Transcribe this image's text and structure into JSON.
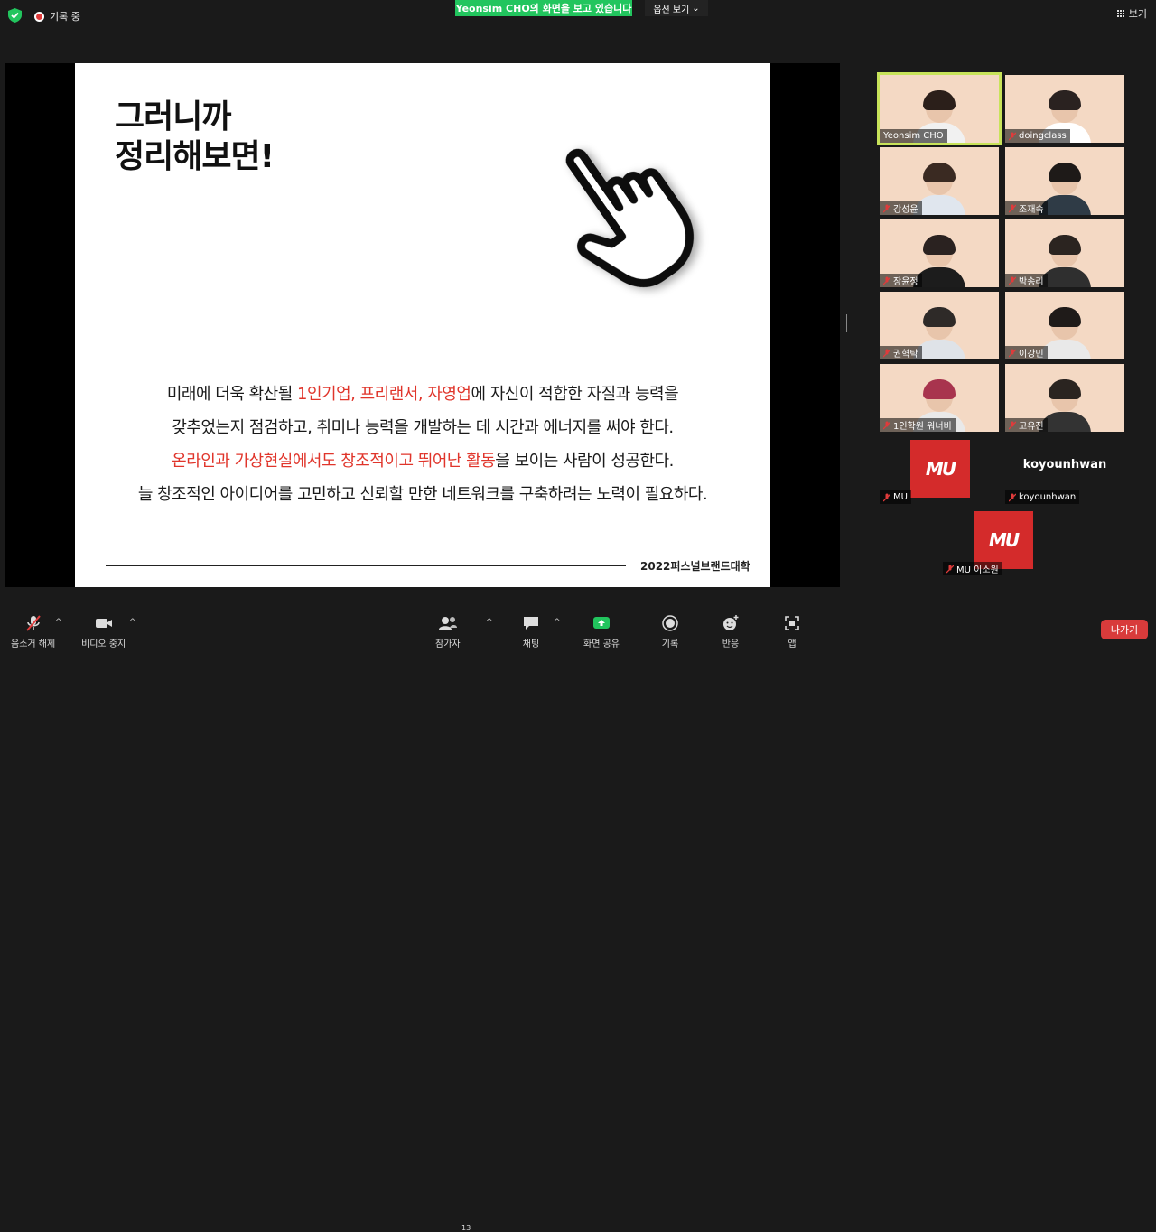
{
  "colors": {
    "share_green": "#22c55e",
    "leave_red": "#d83b3b",
    "accent_red": "#e0352b",
    "active_speaker": "#c8e35a",
    "tile_bg": "#f4d9c4"
  },
  "top": {
    "recording": "기록 중",
    "share_banner": "Yeonsim  CHO의 화면을 보고 있습니다",
    "options": "옵션 보기",
    "view": "보기"
  },
  "slide": {
    "title_line1": "그러니까",
    "title_line2": "정리해보면!",
    "line1_a": "미래에 더욱 확산될 ",
    "line1_red": "1인기업, 프리랜서, 자영업",
    "line1_b": "에 자신이 적합한 자질과 능력을",
    "line2": "갖추었는지 점검하고, 취미나 능력을 개발하는 데 시간과 에너지를 써야 한다.",
    "line3_red": "온라인과 가상현실에서도 창조적이고 뛰어난 활동",
    "line3_b": "을 보이는 사람이 성공한다.",
    "line4": "늘 창조적인 아이디어를 고민하고 신뢰할 만한 네트워크를 구축하려는 노력이 필요하다.",
    "footer": "2022퍼스널브랜드대학"
  },
  "participants": [
    {
      "name": "Yeonsim CHO",
      "muted": false
    },
    {
      "name": "doingclass",
      "muted": true
    },
    {
      "name": "강성윤",
      "muted": true
    },
    {
      "name": "조재숙",
      "muted": true
    },
    {
      "name": "장윤정",
      "muted": true
    },
    {
      "name": "박송리",
      "muted": true
    },
    {
      "name": "권혁탁",
      "muted": true
    },
    {
      "name": "이강민",
      "muted": true
    },
    {
      "name": "1인학원 워너비",
      "muted": true
    },
    {
      "name": "고유진",
      "muted": true
    },
    {
      "name": "MU",
      "muted": true
    },
    {
      "name": "koyounhwan",
      "muted": true
    },
    {
      "name": "MU 이소원",
      "muted": true
    }
  ],
  "tiles_misc": {
    "koyounhwan_display": "koyounhwan",
    "mu_logo": "MU"
  },
  "toolbar": {
    "unmute": "음소거 해제",
    "stop_video": "비디오 중지",
    "participants": "참가자",
    "participants_count": "13",
    "chat": "채팅",
    "share_screen": "화면 공유",
    "record": "기록",
    "reactions": "반응",
    "apps": "앱",
    "leave": "나가기"
  }
}
